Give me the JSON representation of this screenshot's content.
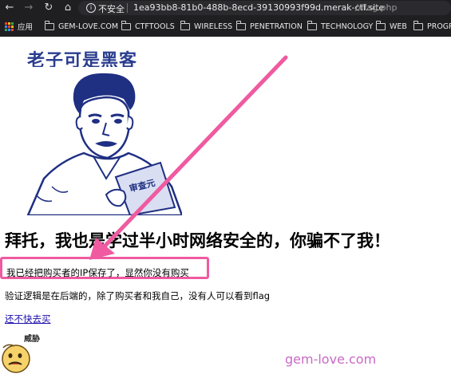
{
  "browser": {
    "insecure_label": "不安全",
    "host": "1ea93bb8-81b0-488b-8ecd-39130993f99d.merak-ctf.site",
    "path": "//flag.php",
    "bookmarks": [
      {
        "label": "应用"
      },
      {
        "label": "GEM-LOVE.COM"
      },
      {
        "label": "CTFTOOLS"
      },
      {
        "label": "WIRELESS"
      },
      {
        "label": "PENETRATION"
      },
      {
        "label": "TECHNOLOGY"
      },
      {
        "label": "WEB"
      },
      {
        "label": "PROGR"
      }
    ]
  },
  "page": {
    "meme_caption": "老子可是黑客",
    "meme_book_text": "审查元",
    "heading": "拜托，我也是学过半小时网络安全的，你骗不了我！",
    "message_ip": "我已经把购买者的IP保存了，显然你没有购买",
    "message_logic": "验证逻辑是在后端的，除了购买者和我自己，没有人可以看到flag",
    "buy_link": "还不快去买",
    "sticker_text": "威胁",
    "watermark": "gem-love.com"
  },
  "colors": {
    "chrome_bg": "#1f1f22",
    "highlight": "#ef5aa0",
    "arrow": "#ef5aa0",
    "watermark": "#c86ac5",
    "meme_ink": "#2a3d8f"
  }
}
